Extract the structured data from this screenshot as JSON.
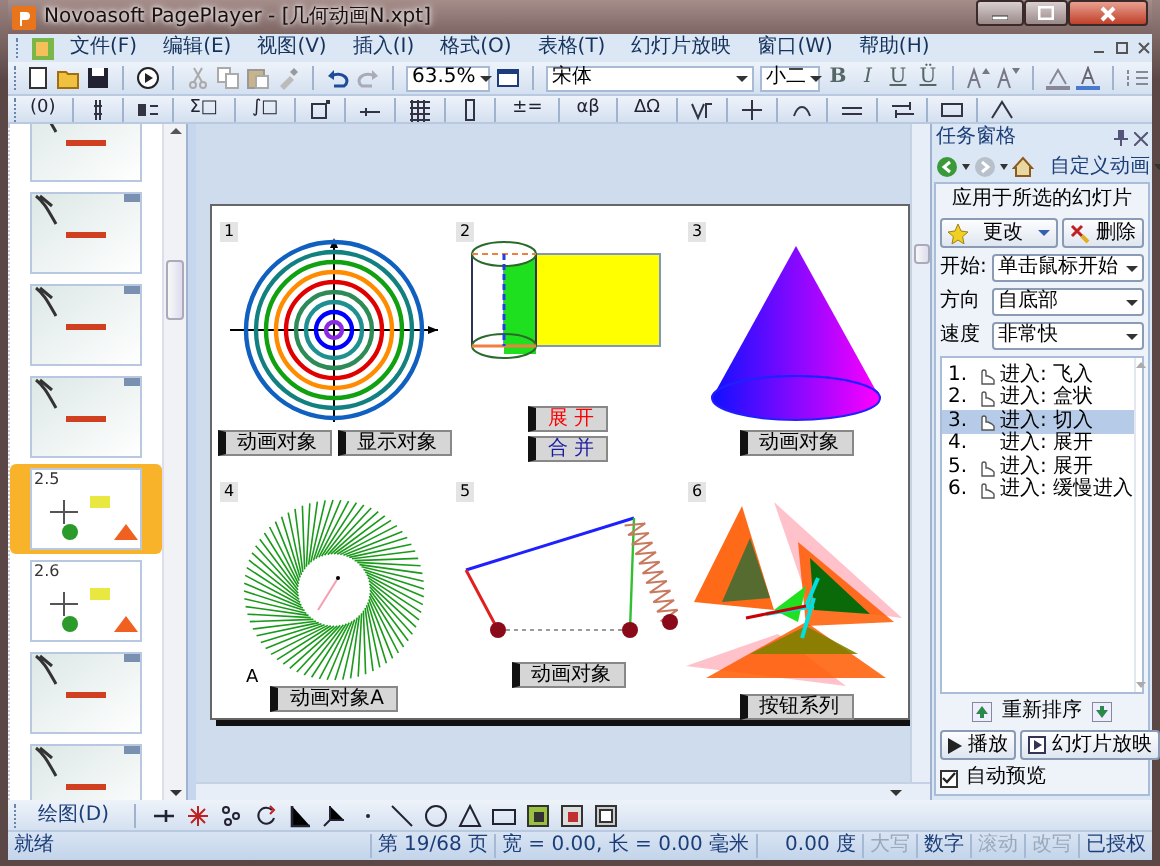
{
  "window": {
    "title": "Novoasoft PagePlayer - [几何动画N.xpt]"
  },
  "menu": {
    "items": [
      "文件(F)",
      "编辑(E)",
      "视图(V)",
      "插入(I)",
      "格式(O)",
      "表格(T)",
      "幻灯片放映",
      "窗口(W)",
      "帮助(H)"
    ]
  },
  "toolbar": {
    "zoom": "63.5%",
    "font": "宋体",
    "font_size": "小二",
    "format_buttons": [
      "B",
      "I",
      "U",
      "Ü"
    ]
  },
  "math_toolbar": {
    "buttons": [
      "(0)",
      "Σ□",
      "∫□",
      "±=",
      "αβ",
      "ΔΩ"
    ]
  },
  "thumbnails": [
    {
      "kind": "painting",
      "selected": false
    },
    {
      "kind": "painting",
      "selected": false
    },
    {
      "kind": "painting",
      "selected": false
    },
    {
      "kind": "painting",
      "selected": false
    },
    {
      "kind": "plain",
      "label": "2.5",
      "selected": true
    },
    {
      "kind": "plain",
      "label": "2.6",
      "selected": false
    },
    {
      "kind": "painting",
      "selected": false
    },
    {
      "kind": "painting",
      "selected": false
    }
  ],
  "slide": {
    "figures": [
      {
        "kind": "spiral",
        "number": "1",
        "buttons": [
          {
            "label": "动画对象",
            "color": "#000000"
          },
          {
            "label": "显示对象",
            "color": "#000000"
          }
        ]
      },
      {
        "kind": "cylinder",
        "number": "2",
        "buttons": [
          {
            "label": "展 开",
            "color": "#ff0000"
          },
          {
            "label": "合 并",
            "color": "#1a1aa0"
          }
        ]
      },
      {
        "kind": "cone",
        "number": "3",
        "buttons": [
          {
            "label": "动画对象",
            "color": "#000000"
          }
        ]
      },
      {
        "kind": "rays",
        "number": "4",
        "point_label": "A",
        "buttons": [
          {
            "label": "动画对象A",
            "color": "#000000"
          }
        ]
      },
      {
        "kind": "linkage",
        "number": "5",
        "buttons": [
          {
            "label": "动画对象",
            "color": "#000000"
          }
        ]
      },
      {
        "kind": "triangles",
        "number": "6",
        "buttons": [
          {
            "label": "按钮系列",
            "color": "#000000"
          }
        ]
      }
    ]
  },
  "task_pane": {
    "title": "任务窗格",
    "view": "自定义动画",
    "apply_label": "应用于所选的幻灯片",
    "change_button": "更改",
    "delete_button": "删除",
    "fields": [
      {
        "label": "开始:",
        "value": "单击鼠标开始"
      },
      {
        "label": "方向",
        "value": "自底部"
      },
      {
        "label": "速度",
        "value": "非常快"
      }
    ],
    "animations": [
      {
        "number": "1.",
        "effect": "进入: 飞入",
        "trigger": true,
        "selected": false
      },
      {
        "number": "2.",
        "effect": "进入: 盒状",
        "trigger": true,
        "selected": false
      },
      {
        "number": "3.",
        "effect": "进入: 切入",
        "trigger": true,
        "selected": true
      },
      {
        "number": "4.",
        "effect": "进入: 展开",
        "trigger": false,
        "selected": false
      },
      {
        "number": "5.",
        "effect": "进入: 展开",
        "trigger": true,
        "selected": false
      },
      {
        "number": "6.",
        "effect": "进入: 缓慢进入",
        "trigger": true,
        "selected": false
      }
    ],
    "reorder_label": "重新排序",
    "play_button": "播放",
    "slideshow_button": "幻灯片放映",
    "autopreview": {
      "label": "自动预览",
      "checked": true
    }
  },
  "drawing_toolbar": {
    "label": "绘图(D)"
  },
  "status_bar": {
    "message": "就绪",
    "page": "第 19/68 页",
    "size": "宽 =  0.00, 长 =  0.00 毫米",
    "angle": "0.00 度",
    "indicators": [
      {
        "label": "大写",
        "enabled": false
      },
      {
        "label": "数字",
        "enabled": true
      },
      {
        "label": "滚动",
        "enabled": false
      },
      {
        "label": "改写",
        "enabled": false
      },
      {
        "label": "已授权",
        "enabled": true
      }
    ]
  }
}
